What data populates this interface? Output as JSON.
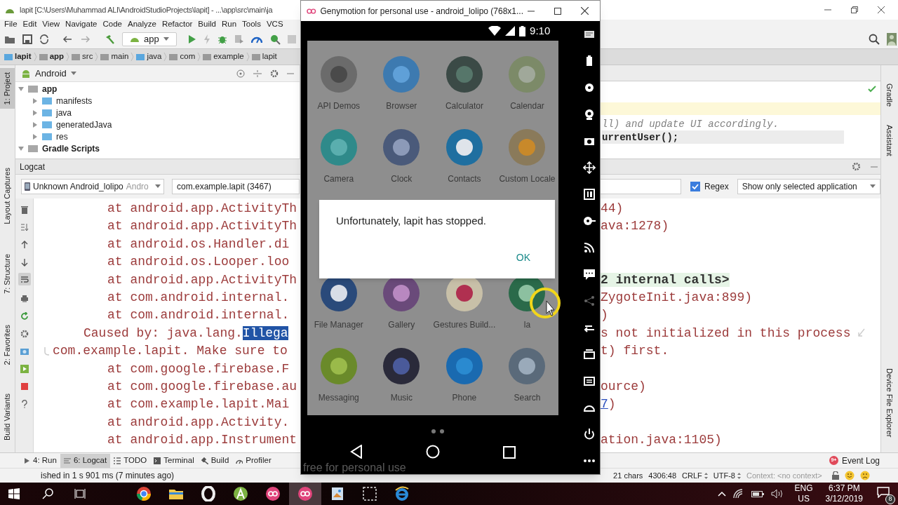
{
  "ide": {
    "title": "lapit [C:\\Users\\Muhammad ALI\\AndroidStudioProjects\\lapit] - ...\\app\\src\\main\\ja",
    "menu": [
      "File",
      "Edit",
      "View",
      "Navigate",
      "Code",
      "Analyze",
      "Refactor",
      "Build",
      "Run",
      "Tools",
      "VCS"
    ],
    "run_config": "app",
    "breadcrumbs": [
      "lapit",
      "app",
      "src",
      "main",
      "java",
      "com",
      "example",
      "lapit"
    ],
    "left_tool_tabs": [
      {
        "label": "1: Project",
        "selected": true
      },
      {
        "label": "Layout Captures",
        "selected": false
      },
      {
        "label": "7: Structure",
        "selected": false
      },
      {
        "label": "2: Favorites",
        "selected": false
      },
      {
        "label": "Build Variants",
        "selected": false
      }
    ],
    "right_tool_tabs": [
      {
        "label": "Gradle",
        "selected": false
      },
      {
        "label": "Assistant",
        "selected": false
      },
      {
        "label": "Device File Explorer",
        "selected": false
      }
    ],
    "project": {
      "view": "Android",
      "tree": [
        {
          "label": "app",
          "expanded": true,
          "children": [
            {
              "label": "manifests",
              "expanded": false
            },
            {
              "label": "java",
              "expanded": false
            },
            {
              "label": "generatedJava",
              "expanded": false
            },
            {
              "label": "res",
              "expanded": false
            }
          ]
        },
        {
          "label": "Gradle Scripts",
          "expanded": true
        }
      ]
    },
    "editor": {
      "lines": [
        {
          "text": "ll) and update UI accordingly.",
          "kind": "comment"
        },
        {
          "text": "urrentUser();",
          "kind": "code"
        }
      ]
    },
    "logcat": {
      "title": "Logcat",
      "device": "Unknown Android_lolipo",
      "device_suffix": "Andro",
      "process": "com.example.lapit (3467)",
      "regex": {
        "label": "Regex",
        "checked": true
      },
      "filter": "Show only selected application",
      "lines": [
        {
          "kind": "frame",
          "left": [
            {
              "text": "at android.app.ActivityTh",
              "kind": "plain"
            }
          ],
          "right": [
            {
              "text": "44)",
              "kind": "plain"
            }
          ]
        },
        {
          "kind": "frame",
          "left": [
            {
              "text": "at android.app.ActivityTh",
              "kind": "plain"
            }
          ],
          "right": [
            {
              "text": "ava:1278)",
              "kind": "plain"
            }
          ]
        },
        {
          "kind": "frame",
          "left": [
            {
              "text": "at android.os.Handler.di",
              "kind": "plain"
            }
          ]
        },
        {
          "kind": "frame",
          "left": [
            {
              "text": "at android.os.Looper.loo",
              "kind": "plain"
            }
          ]
        },
        {
          "kind": "frame",
          "left": [
            {
              "text": "at android.app.ActivityTh",
              "kind": "plain"
            }
          ],
          "right": [
            {
              "text": "2 internal calls>",
              "kind": "folded"
            }
          ]
        },
        {
          "kind": "frame",
          "left": [
            {
              "text": "at com.android.internal.",
              "kind": "plain"
            }
          ],
          "right": [
            {
              "text": "ZygoteInit.java:899)",
              "kind": "plain"
            }
          ]
        },
        {
          "kind": "frame",
          "left": [
            {
              "text": "at com.android.internal.",
              "kind": "plain"
            }
          ],
          "right": [
            {
              "text": ")",
              "kind": "plain"
            }
          ]
        },
        {
          "kind": "cause",
          "left": [
            {
              "text": "Caused by: java.lang.",
              "kind": "plain"
            },
            {
              "text": "Illega",
              "kind": "selected"
            }
          ],
          "right": [
            {
              "text": "s not initialized in this process",
              "kind": "plain"
            }
          ]
        },
        {
          "kind": "continuation",
          "left": [
            {
              "text": "com.example.lapit. Make sure to",
              "kind": "plain"
            }
          ],
          "right": [
            {
              "text": "t) first.",
              "kind": "plain"
            }
          ]
        },
        {
          "kind": "frame",
          "left": [
            {
              "text": "at com.google.firebase.F",
              "kind": "plain"
            }
          ]
        },
        {
          "kind": "frame",
          "left": [
            {
              "text": "at com.google.firebase.au",
              "kind": "plain"
            }
          ],
          "right": [
            {
              "text": "ource)",
              "kind": "plain"
            }
          ]
        },
        {
          "kind": "frame",
          "left": [
            {
              "text": "at com.example.lapit.Mai",
              "kind": "plain"
            }
          ],
          "right": [
            {
              "text": "7",
              "kind": "link"
            },
            {
              "text": ")",
              "kind": "plain"
            }
          ]
        },
        {
          "kind": "frame",
          "left": [
            {
              "text": "at android.app.Activity.",
              "kind": "plain"
            }
          ]
        },
        {
          "kind": "frame",
          "left": [
            {
              "text": "at android.app.Instrument",
              "kind": "plain"
            }
          ],
          "right": [
            {
              "text": "ation.java:1105)",
              "kind": "plain"
            }
          ]
        }
      ]
    },
    "bottom_tabs": [
      {
        "label": "4: Run",
        "selected": false
      },
      {
        "label": "6: Logcat",
        "selected": true
      },
      {
        "label": "TODO",
        "selected": false
      },
      {
        "label": "Terminal",
        "selected": false
      },
      {
        "label": "Build",
        "selected": false
      },
      {
        "label": "Profiler",
        "selected": false
      }
    ],
    "event_log": {
      "label": "Event Log",
      "badge": "9+"
    },
    "status": {
      "message": "ished in 1 s 901 ms (7 minutes ago)",
      "items": [
        "21 chars",
        "4306:48",
        "CRLF",
        "UTF-8",
        "Context: <no context>"
      ]
    }
  },
  "emulator": {
    "title": "Genymotion for personal use - android_lolipo (768x1...",
    "time": "9:10",
    "apps": [
      {
        "label": "API Demos"
      },
      {
        "label": "Browser"
      },
      {
        "label": "Calculator"
      },
      {
        "label": "Calendar"
      },
      {
        "label": "Camera"
      },
      {
        "label": "Clock"
      },
      {
        "label": "Contacts"
      },
      {
        "label": "Custom Locale"
      },
      {
        "label": "File Manager"
      },
      {
        "label": "Gallery"
      },
      {
        "label": "Gestures Build..."
      },
      {
        "label": "la"
      },
      {
        "label": "Messaging"
      },
      {
        "label": "Music"
      },
      {
        "label": "Phone"
      },
      {
        "label": "Search"
      }
    ],
    "dialog": {
      "message": "Unfortunately, lapit has stopped.",
      "button": "OK"
    },
    "watermark": "free for personal use"
  },
  "taskbar": {
    "apps": [
      {
        "kind": "chrome",
        "active": false
      },
      {
        "kind": "explorer",
        "active": false
      },
      {
        "kind": "opera",
        "active": false
      },
      {
        "kind": "studio",
        "active": false
      },
      {
        "kind": "genymotion",
        "active": false
      },
      {
        "kind": "genymotion",
        "active": true
      },
      {
        "kind": "photos",
        "active": false
      },
      {
        "kind": "snip",
        "active": false
      },
      {
        "kind": "ie",
        "active": false
      }
    ],
    "language": "ENG",
    "region": "US",
    "time": "6:37 PM",
    "date": "3/12/2019",
    "notifications": "8"
  }
}
